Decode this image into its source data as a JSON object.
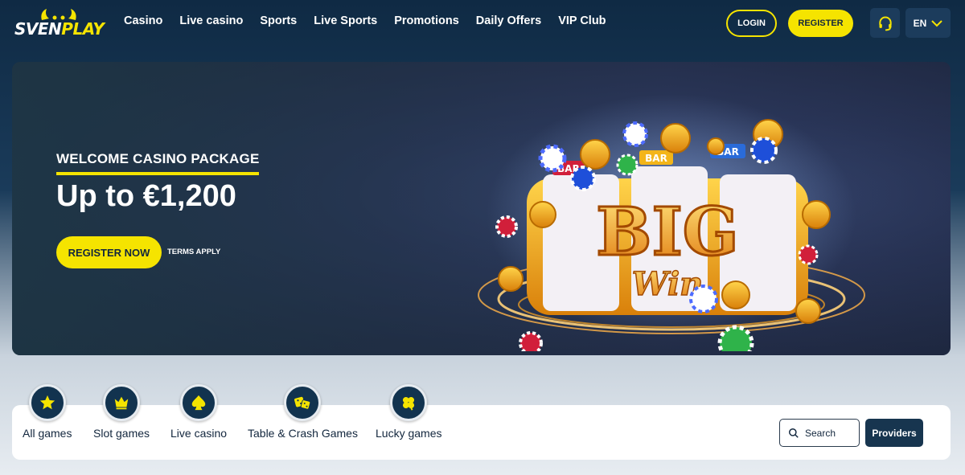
{
  "brand": {
    "logo_text_a": "SVEN",
    "logo_text_b": "PLAY"
  },
  "nav": {
    "items": [
      "Casino",
      "Live casino",
      "Sports",
      "Live Sports",
      "Promotions",
      "Daily Offers",
      "VIP Club"
    ]
  },
  "header": {
    "login_label": "LOGIN",
    "register_label": "REGISTER",
    "language": "EN",
    "support_icon": "headset-icon"
  },
  "hero": {
    "title": "WELCOME CASINO PACKAGE",
    "amount": "Up to €1,200",
    "cta_label": "REGISTER NOW",
    "terms": "TERMS APPLY",
    "art_big": "BIG",
    "art_win": "Win",
    "art_bar": "BAR"
  },
  "categories": {
    "items": [
      {
        "label": "All games",
        "icon": "star-icon"
      },
      {
        "label": "Slot games",
        "icon": "crown-icon"
      },
      {
        "label": "Live casino",
        "icon": "spade-icon"
      },
      {
        "label": "Table & Crash Games",
        "icon": "dice-icon"
      },
      {
        "label": "Lucky games",
        "icon": "clover-icon"
      }
    ],
    "search_label": "Search",
    "providers_label": "Providers"
  },
  "colors": {
    "accent": "#f5e400",
    "navy": "#12334f"
  }
}
